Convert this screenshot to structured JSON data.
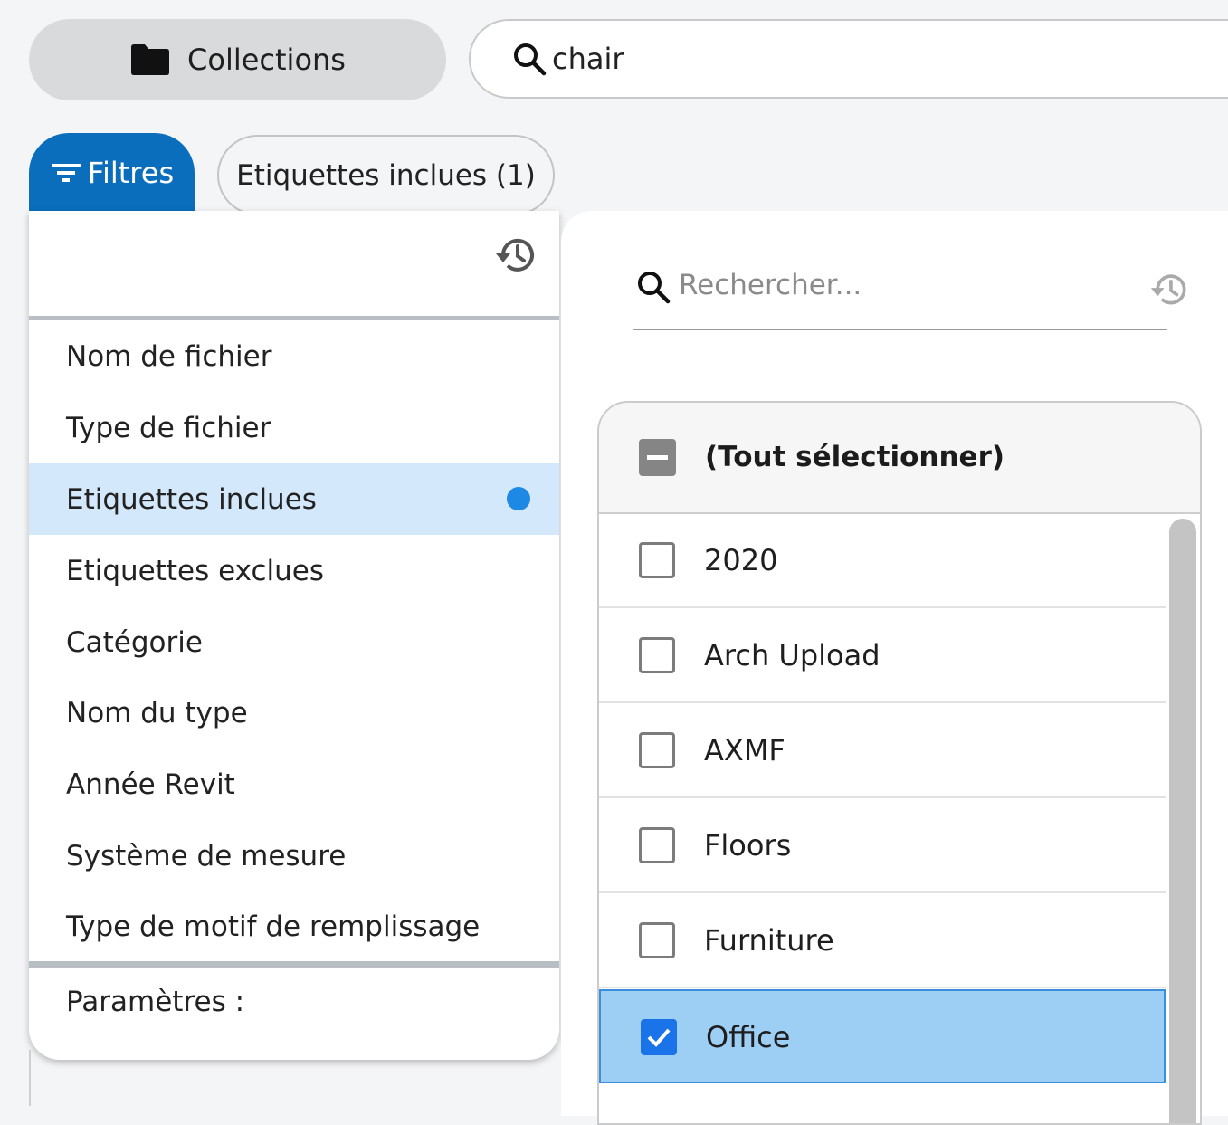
{
  "topbar": {
    "collections_label": "Collections",
    "search_value": "chair"
  },
  "filters": {
    "button_label": "Filtres",
    "chip_label": "Etiquettes inclues (1)"
  },
  "left_menu": {
    "items": [
      {
        "label": "Nom de fichier",
        "active": false
      },
      {
        "label": "Type de fichier",
        "active": false
      },
      {
        "label": "Etiquettes inclues",
        "active": true
      },
      {
        "label": "Etiquettes exclues",
        "active": false
      },
      {
        "label": "Catégorie",
        "active": false
      },
      {
        "label": "Nom du type",
        "active": false
      },
      {
        "label": "Année Revit",
        "active": false
      },
      {
        "label": "Système de mesure",
        "active": false
      },
      {
        "label": "Type de motif de remplissage",
        "active": false
      }
    ],
    "params_label": "Paramètres :"
  },
  "right_panel": {
    "search_placeholder": "Rechercher...",
    "select_all_label": "(Tout sélectionner)",
    "options": [
      {
        "label": "2020",
        "checked": false
      },
      {
        "label": "Arch Upload",
        "checked": false
      },
      {
        "label": "AXMF",
        "checked": false
      },
      {
        "label": "Floors",
        "checked": false
      },
      {
        "label": "Furniture",
        "checked": false
      },
      {
        "label": "Office",
        "checked": true
      }
    ]
  },
  "colors": {
    "accent": "#0a6ebd",
    "active_item_bg": "#d4e8fb",
    "selected_row_bg": "#9dcff5",
    "indicator_dot": "#1e88e5"
  },
  "icons": [
    "folder-icon",
    "search-icon",
    "filter-icon",
    "history-icon",
    "check-icon"
  ]
}
